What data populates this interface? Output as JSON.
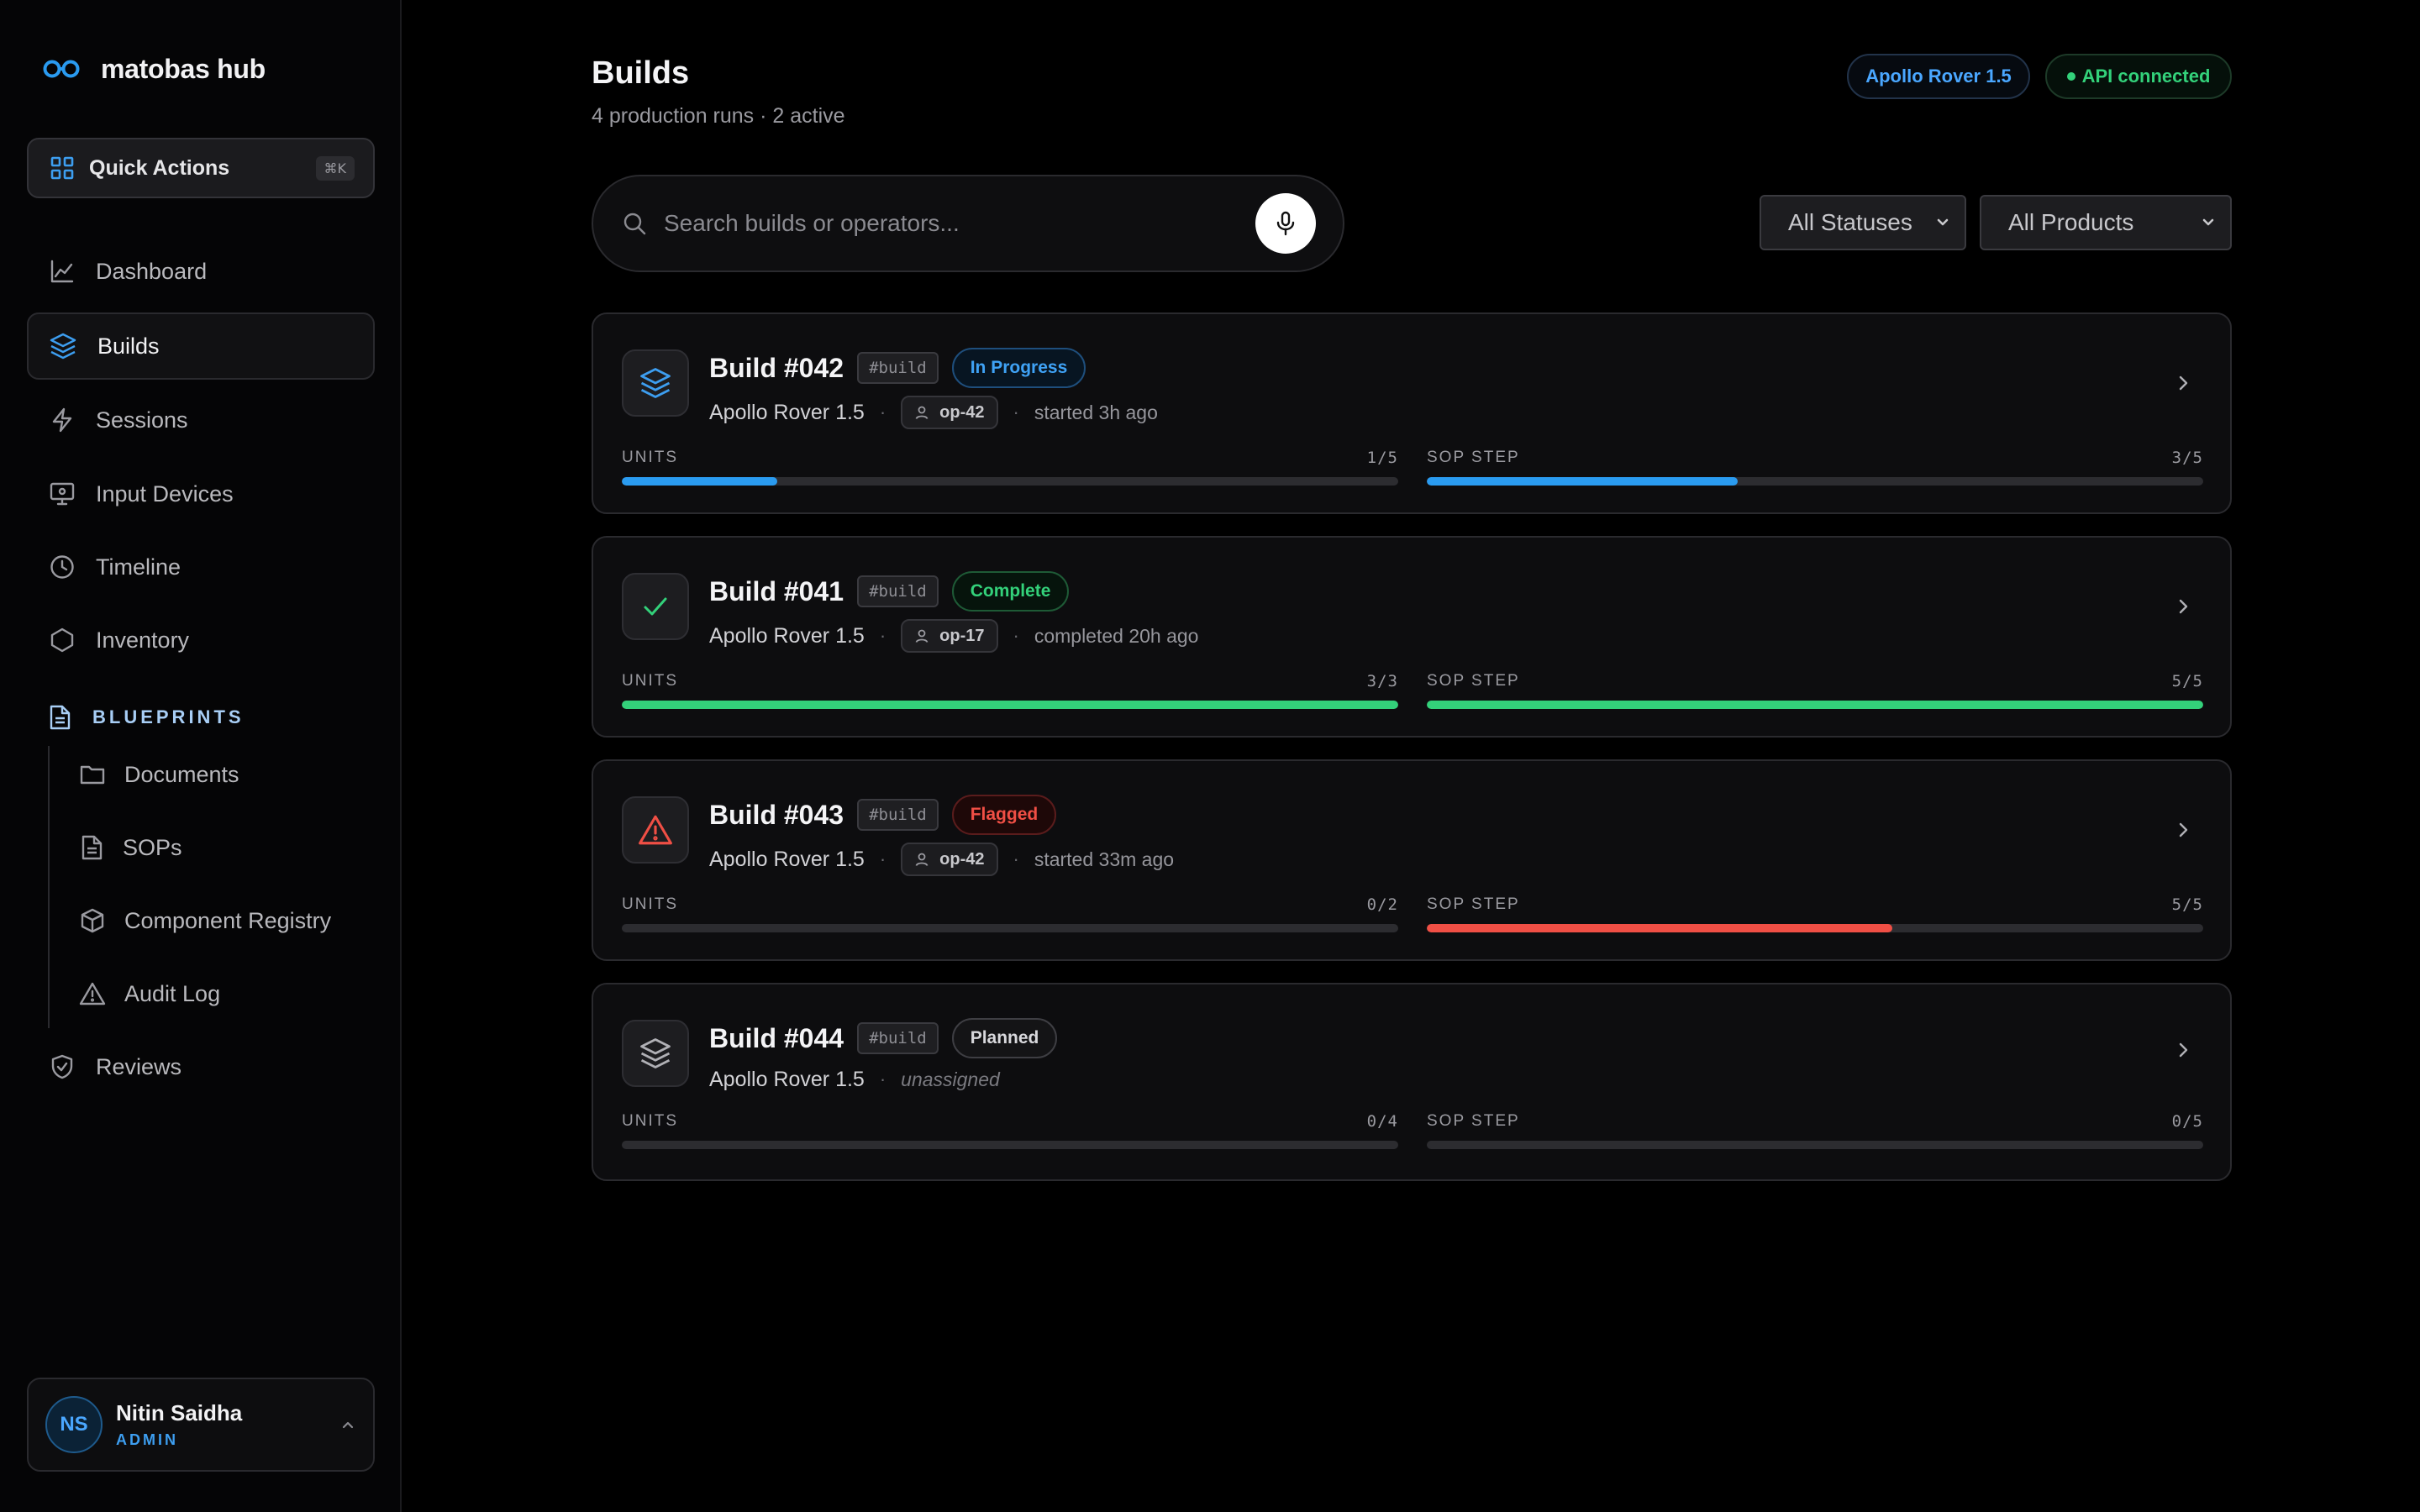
{
  "brand": {
    "name": "matobas hub"
  },
  "quick_actions": {
    "label": "Quick Actions",
    "shortcut": "⌘K"
  },
  "nav": [
    {
      "label": "Dashboard",
      "icon": "chart-icon",
      "active": false
    },
    {
      "label": "Builds",
      "icon": "layers-icon",
      "active": true
    },
    {
      "label": "Sessions",
      "icon": "bolt-icon",
      "active": false
    },
    {
      "label": "Input Devices",
      "icon": "monitor-icon",
      "active": false
    },
    {
      "label": "Timeline",
      "icon": "clock-icon",
      "active": false
    },
    {
      "label": "Inventory",
      "icon": "hexagon-icon",
      "active": false
    }
  ],
  "blueprints": {
    "label": "BLUEPRINTS",
    "items": [
      {
        "label": "Documents",
        "icon": "folder-icon"
      },
      {
        "label": "SOPs",
        "icon": "document-icon"
      },
      {
        "label": "Component Registry",
        "icon": "box-icon"
      },
      {
        "label": "Audit Log",
        "icon": "warning-icon"
      }
    ]
  },
  "reviews": {
    "label": "Reviews",
    "icon": "shield-check-icon"
  },
  "user": {
    "initials": "NS",
    "name": "Nitin Saidha",
    "role": "ADMIN"
  },
  "header": {
    "title": "Builds",
    "subtitle": "4 production runs · 2 active",
    "product_pill": "Apollo Rover 1.5",
    "api_status": "API connected"
  },
  "search": {
    "placeholder": "Search builds or operators..."
  },
  "filters": {
    "status": "All Statuses",
    "product": "All Products"
  },
  "colors": {
    "accent_blue": "#2a9bf0",
    "success_green": "#33d17a",
    "flag_red": "#f04f45",
    "track": "#2c2c30"
  },
  "metric_labels": {
    "units": "UNITS",
    "sop": "SOP STEP"
  },
  "builds": [
    {
      "name": "Build #042",
      "tag": "#build",
      "status": "In Progress",
      "status_kind": "progress",
      "icon": "layers-icon",
      "product": "Apollo Rover 1.5",
      "operator": "op-42",
      "time": "started 3h ago",
      "unassigned": false,
      "units": "1/5",
      "units_fraction": 0.2,
      "units_color": "#2a9bf0",
      "sop": "3/5",
      "sop_fraction": 0.4,
      "sop_color": "#2a9bf0"
    },
    {
      "name": "Build #041",
      "tag": "#build",
      "status": "Complete",
      "status_kind": "complete",
      "icon": "check-icon",
      "product": "Apollo Rover 1.5",
      "operator": "op-17",
      "time": "completed 20h ago",
      "unassigned": false,
      "units": "3/3",
      "units_fraction": 1.0,
      "units_color": "#33d17a",
      "sop": "5/5",
      "sop_fraction": 1.0,
      "sop_color": "#33d17a"
    },
    {
      "name": "Build #043",
      "tag": "#build",
      "status": "Flagged",
      "status_kind": "flagged",
      "icon": "warning-icon",
      "product": "Apollo Rover 1.5",
      "operator": "op-42",
      "time": "started 33m ago",
      "unassigned": false,
      "units": "0/2",
      "units_fraction": 0.0,
      "units_color": "#f04f45",
      "sop": "5/5",
      "sop_fraction": 0.6,
      "sop_color": "#f04f45"
    },
    {
      "name": "Build #044",
      "tag": "#build",
      "status": "Planned",
      "status_kind": "planned",
      "icon": "layers-icon",
      "product": "Apollo Rover 1.5",
      "operator": "",
      "time": "unassigned",
      "unassigned": true,
      "units": "0/4",
      "units_fraction": 0.0,
      "units_color": "#2a9bf0",
      "sop": "0/5",
      "sop_fraction": 0.0,
      "sop_color": "#2a9bf0"
    }
  ]
}
